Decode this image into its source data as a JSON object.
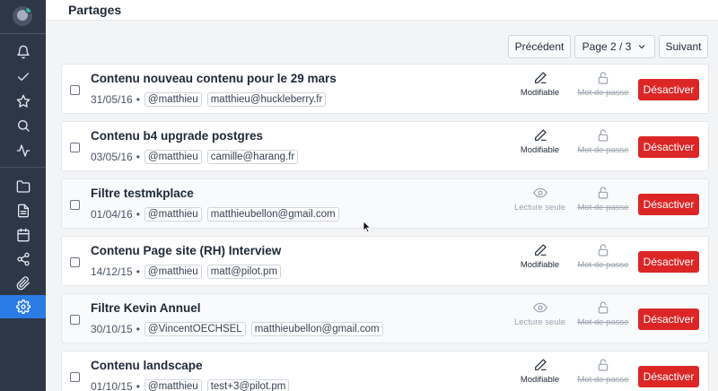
{
  "header": {
    "title": "Partages"
  },
  "sidebar": {
    "items": [
      {
        "icon": "bell-icon"
      },
      {
        "icon": "check-icon"
      },
      {
        "icon": "star-icon"
      },
      {
        "icon": "search-icon"
      },
      {
        "icon": "activity-icon"
      },
      {
        "icon": "folder-icon"
      },
      {
        "icon": "document-icon"
      },
      {
        "icon": "calendar-icon"
      },
      {
        "icon": "share-icon"
      },
      {
        "icon": "paperclip-icon"
      },
      {
        "icon": "gear-icon",
        "active": true
      }
    ]
  },
  "pager": {
    "prev_label": "Précédent",
    "page_label": "Page 2 / 3",
    "next_label": "Suivant"
  },
  "shares": [
    {
      "title": "Contenu nouveau contenu pour le 29 mars",
      "date": "31/05/16",
      "user": "@matthieu",
      "email": "matthieu@huckleberry.fr",
      "mode": "Modifiable",
      "mode_icon": "pencil-icon",
      "editable": true,
      "password": "Mot de passe",
      "action": "Désactiver"
    },
    {
      "title": "Contenu b4 upgrade postgres",
      "date": "03/05/16",
      "user": "@matthieu",
      "email": "camille@harang.fr",
      "mode": "Modifiable",
      "mode_icon": "pencil-icon",
      "editable": true,
      "password": "Mot de passe",
      "action": "Désactiver"
    },
    {
      "title": "Filtre testmkplace",
      "date": "01/04/16",
      "user": "@matthieu",
      "email": "matthieubellon@gmail.com",
      "mode": "Lecture seule",
      "mode_icon": "eye-icon",
      "editable": false,
      "password": "Mot de passe",
      "action": "Désactiver"
    },
    {
      "title": "Contenu Page site (RH) Interview",
      "date": "14/12/15",
      "user": "@matthieu",
      "email": "matt@pilot.pm",
      "mode": "Modifiable",
      "mode_icon": "pencil-icon",
      "editable": true,
      "password": "Mot de passe",
      "action": "Désactiver"
    },
    {
      "title": "Filtre Kevin Annuel",
      "date": "30/10/15",
      "user": "@VincentOECHSEL",
      "email": "matthieubellon@gmail.com",
      "mode": "Lecture seule",
      "mode_icon": "eye-icon",
      "editable": false,
      "password": "Mot de passe",
      "action": "Désactiver"
    },
    {
      "title": "Contenu landscape",
      "date": "01/10/15",
      "user": "@matthieu",
      "email": "test+3@pilot.pm",
      "mode": "Modifiable",
      "mode_icon": "pencil-icon",
      "editable": true,
      "password": "Mot de passe",
      "action": "Désactiver"
    }
  ],
  "colors": {
    "accent": "#2b7be5",
    "danger": "#dc2626",
    "sidebar": "#2d3748"
  }
}
